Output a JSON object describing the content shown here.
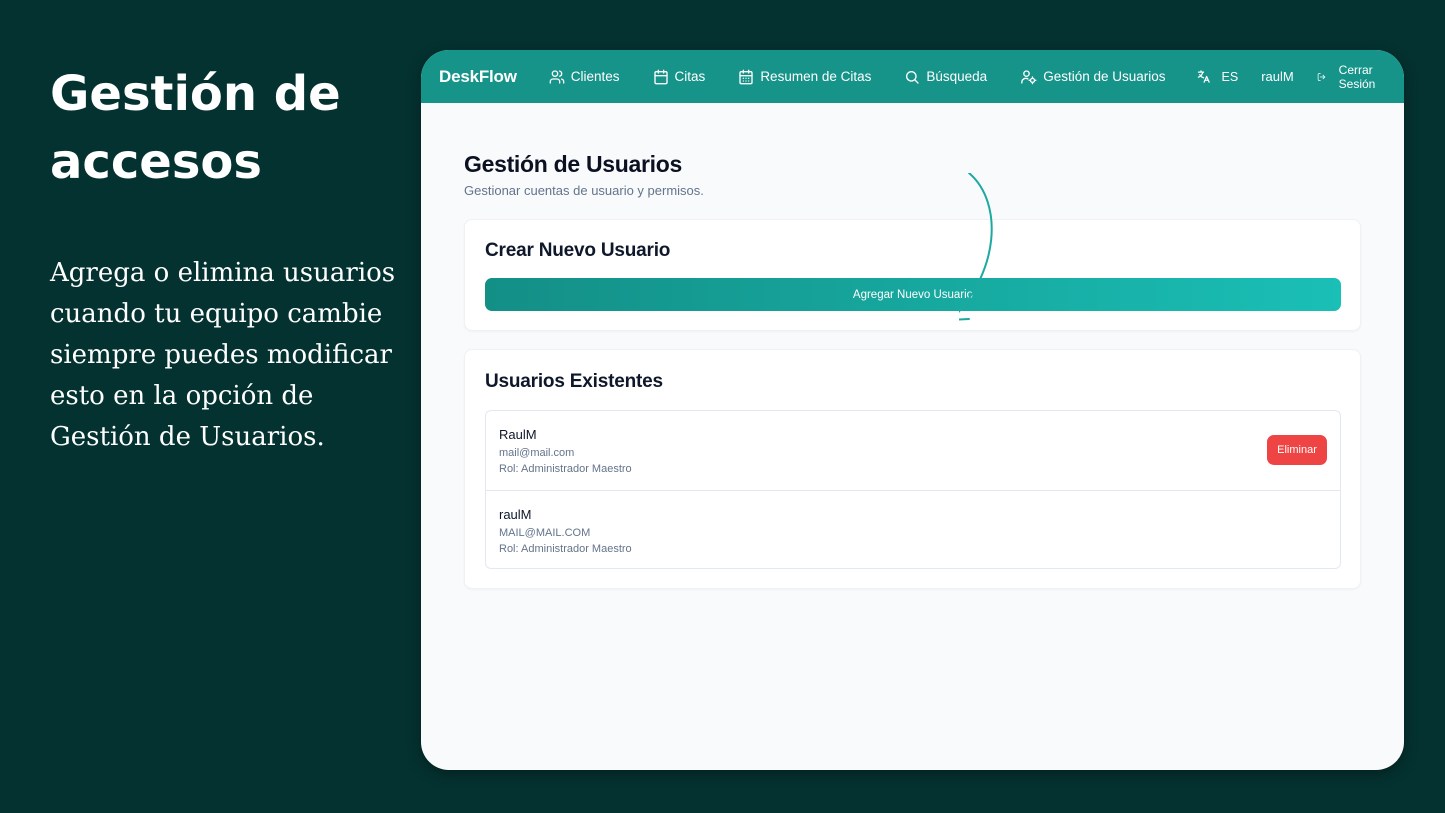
{
  "slide": {
    "title": "Gestión de accesos",
    "description": "Agrega o elimina usuarios cuando tu equipo cambie siempre puedes modificar esto en la opción de Gestión de Usuarios."
  },
  "navbar": {
    "brand": "DeskFlow",
    "items": [
      {
        "label": "Clientes",
        "icon": "users-icon"
      },
      {
        "label": "Citas",
        "icon": "calendar-icon"
      },
      {
        "label": "Resumen de Citas",
        "icon": "calendar-days-icon"
      },
      {
        "label": "Búsqueda",
        "icon": "search-icon"
      },
      {
        "label": "Gestión de Usuarios",
        "icon": "user-cog-icon"
      }
    ],
    "language": "ES",
    "username": "raulM",
    "logout": "Cerrar Sesión"
  },
  "page": {
    "title": "Gestión de Usuarios",
    "subtitle": "Gestionar cuentas de usuario y permisos."
  },
  "create_card": {
    "title": "Crear Nuevo Usuario",
    "button": "Agregar Nuevo Usuario"
  },
  "users_card": {
    "title": "Usuarios Existentes",
    "delete_label": "Eliminar",
    "users": [
      {
        "name": "RaulM",
        "email": "mail@mail.com",
        "role": "Rol: Administrador Maestro"
      },
      {
        "name": "raulM",
        "email": "MAIL@MAIL.COM",
        "role": "Rol: Administrador Maestro"
      }
    ]
  },
  "colors": {
    "background": "#043230",
    "navbar": "#17948a",
    "accent_start": "#138f86",
    "accent_end": "#1abfb6",
    "danger": "#ef4444",
    "arrow": "#1ea9a0"
  }
}
